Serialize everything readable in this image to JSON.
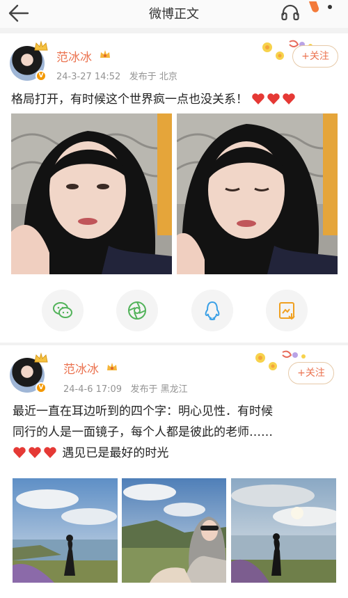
{
  "header": {
    "title": "微博正文",
    "back_icon": "back-arrow-icon",
    "headset_icon": "headphones-icon",
    "accent_color": "#f37a3a"
  },
  "posts": [
    {
      "username": "范冰冰",
      "datetime": "24-3-27 14:52",
      "location": "发布于 北京",
      "follow_label": "+关注",
      "text_lines": [
        "格局打开，有时候这个世界疯一点也没关系！"
      ],
      "trailing_hearts": 3,
      "photo_count": 2
    },
    {
      "username": "范冰冰",
      "datetime": "24-4-6 17:09",
      "location": "发布于 黑龙江",
      "follow_label": "+关注",
      "text_lines": [
        "最近一直在耳边听到的四个字：明心见性．有时候",
        "同行的人是一面镜子，每个人都是彼此的老师……"
      ],
      "last_line_text": "遇见已是最好的时光",
      "leading_hearts": 3,
      "photo_count": 3
    }
  ],
  "share_icons": [
    "wechat-icon",
    "moments-icon",
    "qq-icon",
    "save-image-icon"
  ],
  "colors": {
    "username": "#eb7350",
    "meta": "#939393",
    "heart": "#e53935",
    "wechat": "#52b35a",
    "qq": "#3aa0e6",
    "save": "#f0a020"
  }
}
